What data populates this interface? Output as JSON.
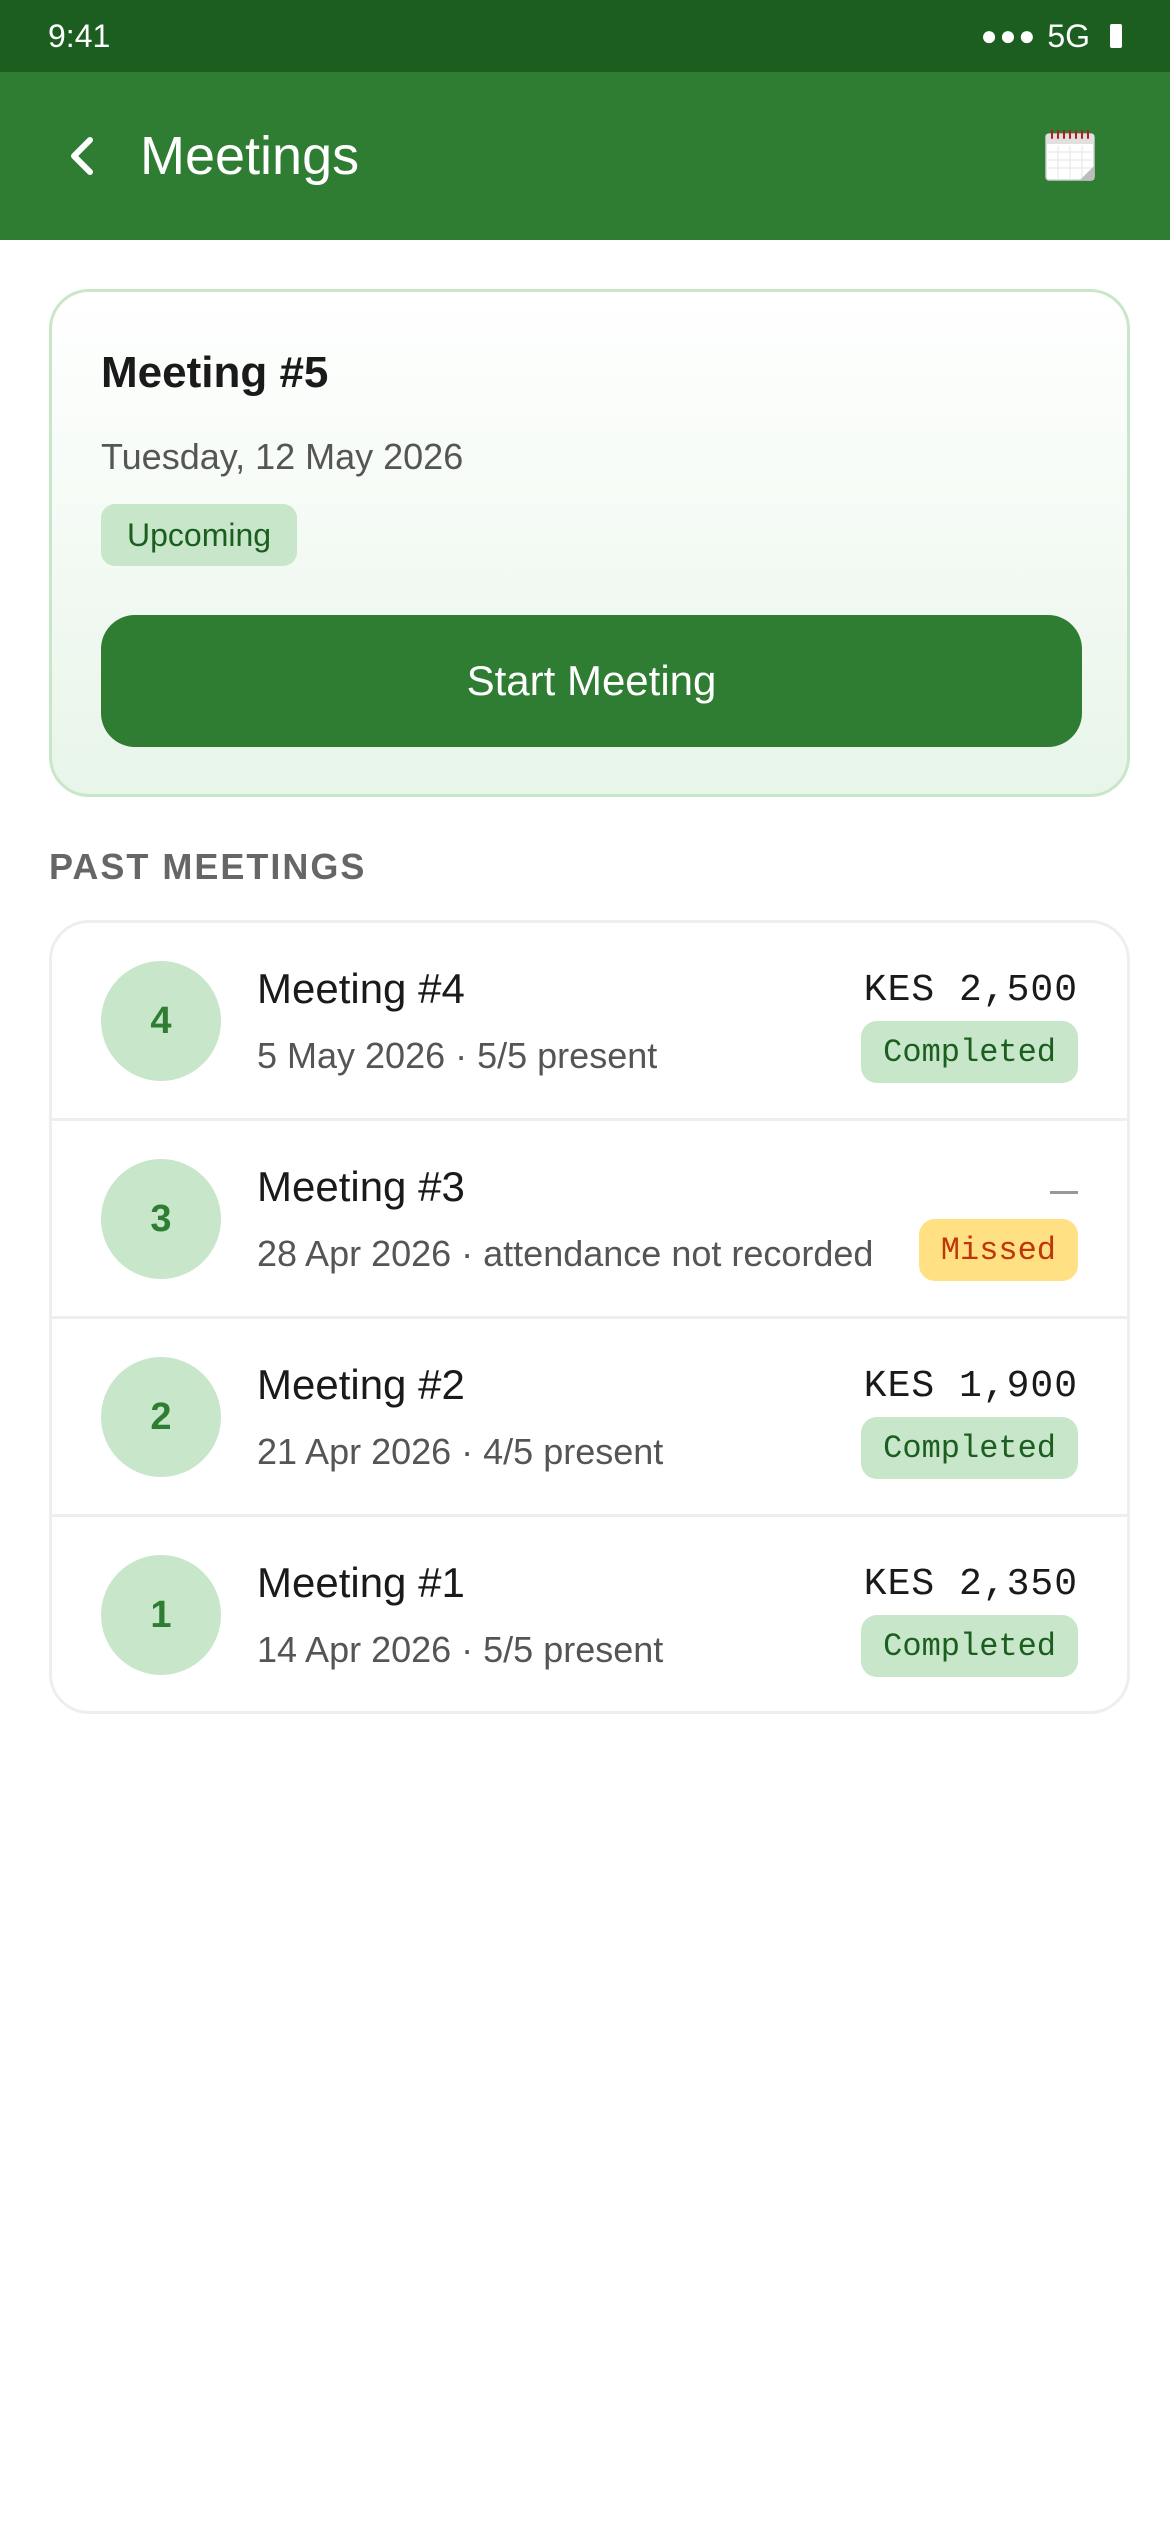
{
  "status_bar": {
    "time": "9:41",
    "signal": "●●●",
    "network": "5G"
  },
  "app_bar": {
    "title": "Meetings",
    "back_icon": "chevron-left-icon",
    "action_icon": "calendar-icon"
  },
  "upcoming": {
    "title": "Meeting #5",
    "date": "Tuesday, 12 May 2026",
    "badge": "Upcoming",
    "button_label": "Start Meeting"
  },
  "past_section": {
    "title": "PAST MEETINGS"
  },
  "meetings": [
    {
      "number": "4",
      "name": "Meeting #4",
      "subtitle": "5 May 2026 · 5/5 present",
      "amount": "KES 2,500",
      "status": "Completed",
      "status_type": "completed"
    },
    {
      "number": "3",
      "name": "Meeting #3",
      "subtitle": "28 Apr 2026 · attendance not recorded",
      "amount": "",
      "status": "Missed",
      "status_type": "missed"
    },
    {
      "number": "2",
      "name": "Meeting #2",
      "subtitle": "21 Apr 2026 · 4/5 present",
      "amount": "KES 1,900",
      "status": "Completed",
      "status_type": "completed"
    },
    {
      "number": "1",
      "name": "Meeting #1",
      "subtitle": "14 Apr 2026 · 5/5 present",
      "amount": "KES 2,350",
      "status": "Completed",
      "status_type": "completed"
    }
  ],
  "colors": {
    "primary": "#2e7d32",
    "primary_dark": "#1b5e20",
    "badge_green_bg": "#c8e6c9",
    "badge_missed_bg": "#ffe082",
    "badge_missed_text": "#bf360c"
  }
}
